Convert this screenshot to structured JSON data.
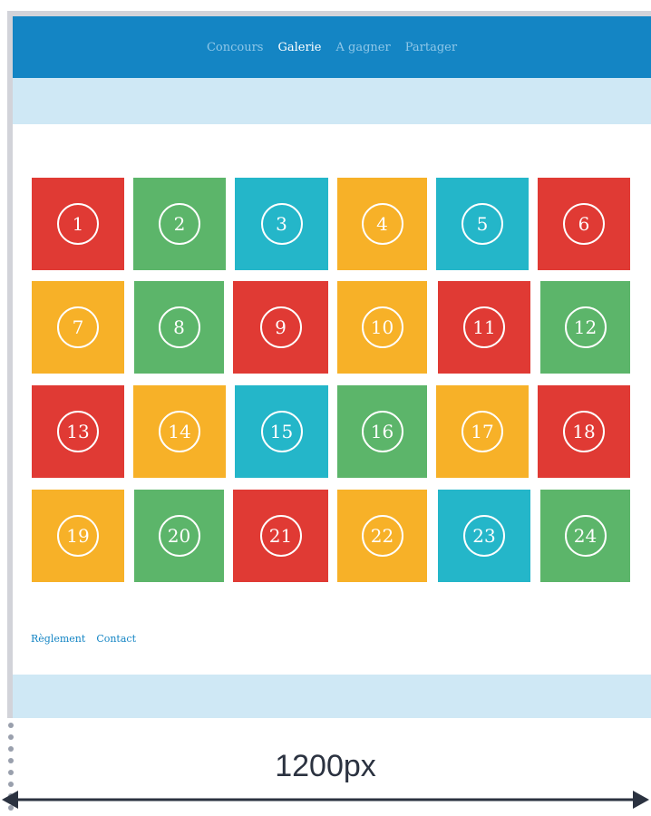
{
  "nav": {
    "items": [
      {
        "label": "Concours",
        "active": false
      },
      {
        "label": "Galerie",
        "active": true
      },
      {
        "label": "A gagner",
        "active": false
      },
      {
        "label": "Partager",
        "active": false
      }
    ]
  },
  "gallery": {
    "tiles": [
      {
        "label": "1",
        "color": "#e03a34"
      },
      {
        "label": "2",
        "color": "#5cb56a"
      },
      {
        "label": "3",
        "color": "#24b6c9"
      },
      {
        "label": "4",
        "color": "#f7b128"
      },
      {
        "label": "5",
        "color": "#24b6c9"
      },
      {
        "label": "6",
        "color": "#e03a34"
      },
      {
        "label": "7",
        "color": "#f7b128"
      },
      {
        "label": "8",
        "color": "#5cb56a"
      },
      {
        "label": "9",
        "color": "#e03a34"
      },
      {
        "label": "10",
        "color": "#f7b128"
      },
      {
        "label": "11",
        "color": "#e03a34"
      },
      {
        "label": "12",
        "color": "#5cb56a"
      },
      {
        "label": "13",
        "color": "#e03a34"
      },
      {
        "label": "14",
        "color": "#f7b128"
      },
      {
        "label": "15",
        "color": "#24b6c9"
      },
      {
        "label": "16",
        "color": "#5cb56a"
      },
      {
        "label": "17",
        "color": "#f7b128"
      },
      {
        "label": "18",
        "color": "#e03a34"
      },
      {
        "label": "19",
        "color": "#f7b128"
      },
      {
        "label": "20",
        "color": "#5cb56a"
      },
      {
        "label": "21",
        "color": "#e03a34"
      },
      {
        "label": "22",
        "color": "#f7b128"
      },
      {
        "label": "23",
        "color": "#24b6c9"
      },
      {
        "label": "24",
        "color": "#5cb56a"
      }
    ]
  },
  "footer": {
    "links": [
      "Règlement",
      "Contact"
    ]
  },
  "measure": {
    "label": "1200px"
  },
  "colors": {
    "nav_bg": "#1485c4",
    "band_bg": "#cfe8f5",
    "frame": "#d2d3d9",
    "arrow": "#2b3240"
  }
}
